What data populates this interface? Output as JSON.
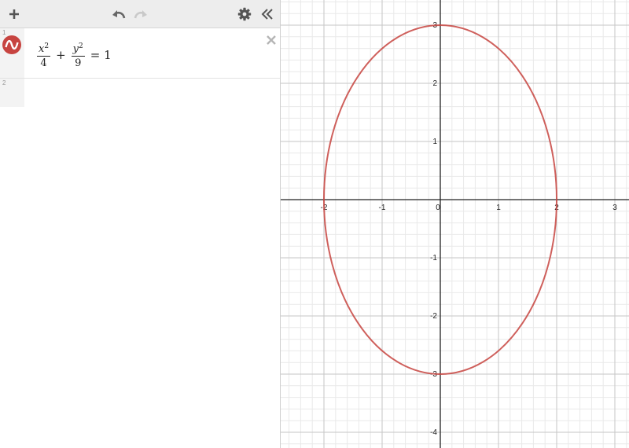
{
  "toolbar": {
    "add_icon": "plus-icon",
    "undo_icon": "undo-icon",
    "redo_icon": "redo-icon",
    "settings_icon": "gear-icon",
    "collapse_icon": "double-chevron-left-icon"
  },
  "expressions": [
    {
      "index": "1",
      "color": "#c74440",
      "icon": "graph-wave-icon",
      "term1": {
        "var": "x",
        "exp": "2",
        "den": "4"
      },
      "plus": "+",
      "term2": {
        "var": "y",
        "exp": "2",
        "den": "9"
      },
      "rhs": "= 1"
    },
    {
      "index": "2"
    }
  ],
  "graph": {
    "x_ticks": [
      "-2",
      "-1",
      "0",
      "1",
      "2",
      "3"
    ],
    "y_ticks": [
      "3",
      "2",
      "1",
      "-1",
      "-2",
      "-3",
      "-4"
    ],
    "grid": true,
    "curve_color": "#c74440"
  },
  "chart_data": {
    "type": "line",
    "title": "",
    "xlabel": "",
    "ylabel": "",
    "xlim": [
      -2.7,
      3.3
    ],
    "ylim": [
      -4.3,
      3.4
    ],
    "x_ticks": [
      -2,
      -1,
      0,
      1,
      2,
      3
    ],
    "y_ticks": [
      -4,
      -3,
      -2,
      -1,
      1,
      2,
      3
    ],
    "grid": true,
    "series": [
      {
        "equation": "x^2/4 + y^2/9 = 1",
        "shape": "ellipse",
        "center": [
          0,
          0
        ],
        "semi_axis_x": 2,
        "semi_axis_y": 3,
        "key_points": [
          [
            -2,
            0
          ],
          [
            2,
            0
          ],
          [
            0,
            3
          ],
          [
            0,
            -3
          ]
        ]
      }
    ]
  }
}
